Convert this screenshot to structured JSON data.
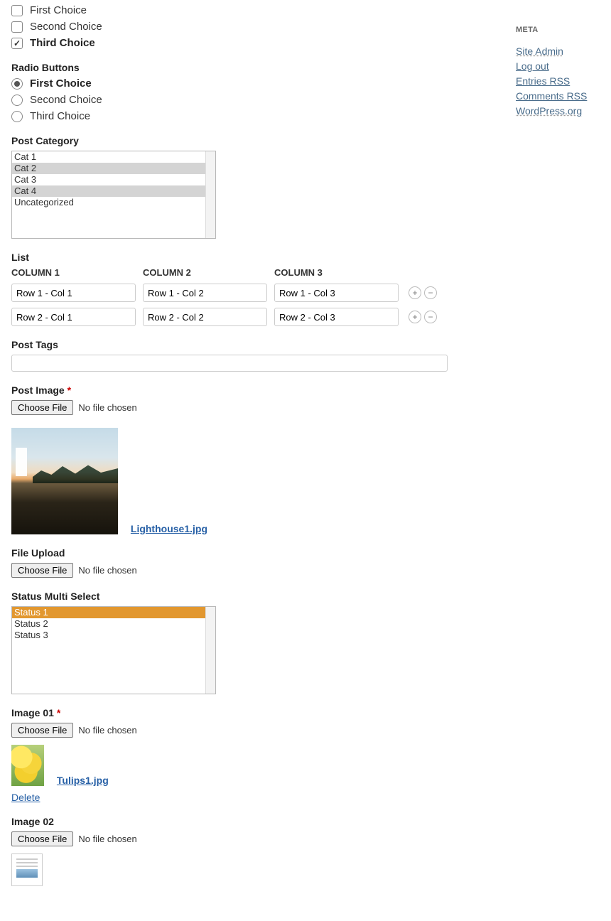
{
  "checkboxes": {
    "items": [
      {
        "label": "First Choice",
        "checked": false
      },
      {
        "label": "Second Choice",
        "checked": false
      },
      {
        "label": "Third Choice",
        "checked": true
      }
    ]
  },
  "radio": {
    "title": "Radio Buttons",
    "items": [
      {
        "label": "First Choice",
        "checked": true
      },
      {
        "label": "Second Choice",
        "checked": false
      },
      {
        "label": "Third Choice",
        "checked": false
      }
    ]
  },
  "post_category": {
    "title": "Post Category",
    "options": [
      {
        "label": "Cat 1",
        "sel": ""
      },
      {
        "label": "Cat 2",
        "sel": "g"
      },
      {
        "label": "Cat 3",
        "sel": ""
      },
      {
        "label": "Cat 4",
        "sel": "g"
      },
      {
        "label": "Uncategorized",
        "sel": ""
      }
    ]
  },
  "list": {
    "title": "List",
    "cols": [
      "COLUMN 1",
      "COLUMN 2",
      "COLUMN 3"
    ],
    "rows": [
      [
        "Row 1 - Col 1",
        "Row 1 - Col 2",
        "Row 1 - Col 3"
      ],
      [
        "Row 2 - Col 1",
        "Row 2 - Col 2",
        "Row 2 - Col 3"
      ]
    ]
  },
  "post_tags": {
    "title": "Post Tags",
    "value": ""
  },
  "post_image": {
    "title": "Post Image",
    "button": "Choose File",
    "status": "No file chosen",
    "filename": "Lighthouse1.jpg"
  },
  "file_upload": {
    "title": "File Upload",
    "button": "Choose File",
    "status": "No file chosen"
  },
  "status_ms": {
    "title": "Status Multi Select",
    "options": [
      {
        "label": "Status 1",
        "sel": "o"
      },
      {
        "label": "Status 2",
        "sel": ""
      },
      {
        "label": "Status 3",
        "sel": ""
      }
    ]
  },
  "image01": {
    "title": "Image 01",
    "button": "Choose File",
    "status": "No file chosen",
    "filename": "Tulips1.jpg",
    "del": "Delete"
  },
  "image02": {
    "title": "Image 02",
    "button": "Choose File",
    "status": "No file chosen"
  },
  "sidebar": {
    "title": "META",
    "links": [
      "Site Admin",
      "Log out",
      "Entries RSS",
      "Comments RSS",
      "WordPress.org"
    ]
  }
}
